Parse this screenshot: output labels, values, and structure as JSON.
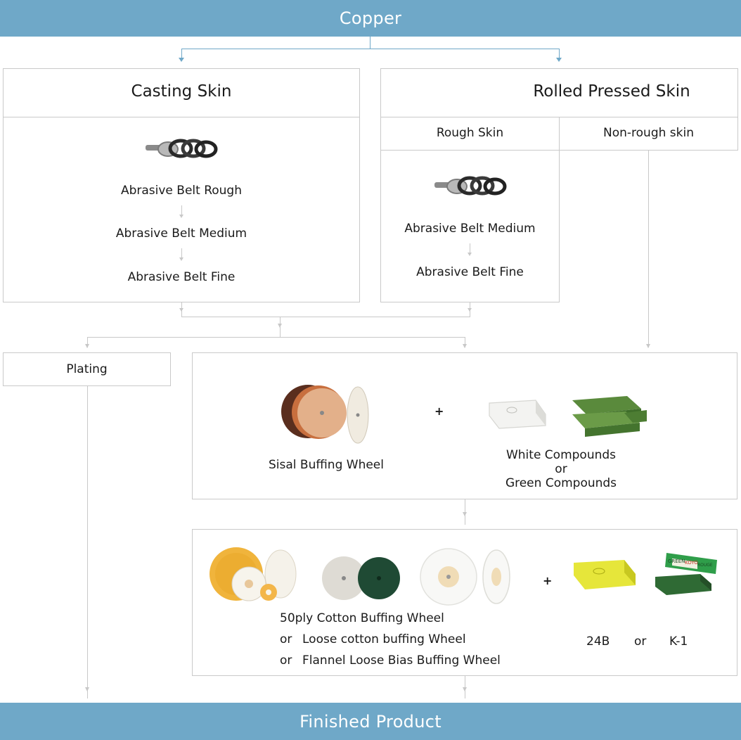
{
  "top_banner": "Copper",
  "bottom_banner": "Finished Product",
  "casting": {
    "title": "Casting Skin",
    "steps": [
      "Abrasive Belt Rough",
      "Abrasive Belt Medium",
      "Abrasive Belt Fine"
    ]
  },
  "rolled": {
    "title": "Rolled Pressed Skin",
    "rough_label": "Rough Skin",
    "nonrough_label": "Non-rough skin",
    "steps": [
      "Abrasive Belt Medium",
      "Abrasive Belt Fine"
    ]
  },
  "plating": "Plating",
  "stage1": {
    "wheel": "Sisal Buffing Wheel",
    "plus": "+",
    "compound_line1": "White Compounds",
    "compound_or": "or",
    "compound_line2": "Green Compounds"
  },
  "stage2": {
    "wheel_line1": "50ply Cotton Buffing Wheel",
    "or1": "or",
    "wheel_line2": "Loose cotton buffing Wheel",
    "or2": "or",
    "wheel_line3": "Flannel Loose Bias Buffing Wheel",
    "plus": "+",
    "comp_a": "24B",
    "comp_or": "or",
    "comp_b": "K-1",
    "bar_text_top": "GREEN",
    "bar_text_brand": "KOYO",
    "bar_text_bottom": "ROUGE"
  },
  "colors": {
    "banner": "#6fa8c8",
    "border": "#c9c9c9",
    "connector": "#c8c8c8"
  }
}
